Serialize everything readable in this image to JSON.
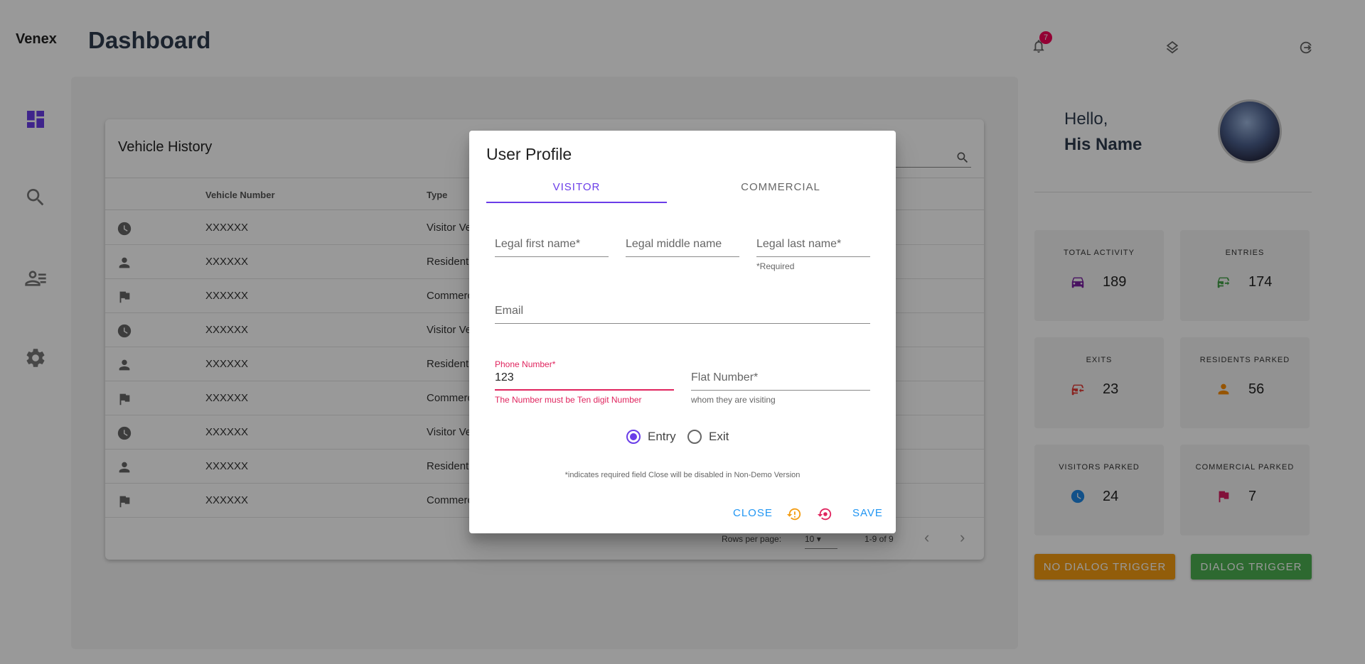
{
  "app": {
    "brand": "Venex",
    "page_title": "Dashboard",
    "notification_count": "7"
  },
  "history": {
    "title": "Vehicle History",
    "columns": [
      "Vehicle Number",
      "Type"
    ],
    "rows": [
      {
        "icon": "clock-icon",
        "number": "XXXXXX",
        "type": "Visitor Ve"
      },
      {
        "icon": "person-icon",
        "number": "XXXXXX",
        "type": "Resident"
      },
      {
        "icon": "flag-icon",
        "number": "XXXXXX",
        "type": "Commerc"
      },
      {
        "icon": "clock-icon",
        "number": "XXXXXX",
        "type": "Visitor Ve"
      },
      {
        "icon": "person-icon",
        "number": "XXXXXX",
        "type": "Resident"
      },
      {
        "icon": "flag-icon",
        "number": "XXXXXX",
        "type": "Commerc"
      },
      {
        "icon": "clock-icon",
        "number": "XXXXXX",
        "type": "Visitor Ve"
      },
      {
        "icon": "person-icon",
        "number": "XXXXXX",
        "type": "Resident"
      },
      {
        "icon": "flag-icon",
        "number": "XXXXXX",
        "type": "Commerc"
      }
    ],
    "rows_per_page_label": "Rows per page:",
    "rows_per_page": "10",
    "range": "1-9 of 9"
  },
  "profile": {
    "hello": "Hello,",
    "name": "His Name"
  },
  "stats": [
    {
      "label": "TOTAL ACTIVITY",
      "value": "189",
      "icon": "car-icon",
      "color": "#7b1fa2"
    },
    {
      "label": "ENTRIES",
      "value": "174",
      "icon": "car-entry-icon",
      "color": "#43a047"
    },
    {
      "label": "EXITS",
      "value": "23",
      "icon": "car-exit-icon",
      "color": "#e53935"
    },
    {
      "label": "RESIDENTS PARKED",
      "value": "56",
      "icon": "person-icon",
      "color": "#fb8c00"
    },
    {
      "label": "VISITORS PARKED",
      "value": "24",
      "icon": "clock-icon",
      "color": "#1e88e5"
    },
    {
      "label": "COMMERCIAL PARKED",
      "value": "7",
      "icon": "flag-icon",
      "color": "#d81b60"
    }
  ],
  "triggers": {
    "no_dialog": "NO DIALOG TRIGGER",
    "dialog": "DIALOG TRIGGER",
    "no_dialog_color": "#f39c12",
    "dialog_color": "#4caf50"
  },
  "dialog": {
    "title": "User Profile",
    "tabs": [
      "VISITOR",
      "COMMERCIAL"
    ],
    "active_tab": "VISITOR",
    "fields": {
      "first_name": "Legal first name*",
      "middle_name": "Legal middle name",
      "last_name": "Legal last name*",
      "last_name_helper": "*Required",
      "email": "Email",
      "phone_label": "Phone Number*",
      "phone_value": "123",
      "phone_error": "The Number must be Ten digit Number",
      "flat": "Flat Number*",
      "flat_helper": "whom they are visiting"
    },
    "radio": {
      "options": [
        "Entry",
        "Exit"
      ],
      "selected": "Entry"
    },
    "note": "*indicates required field Close will be disabled in Non-Demo Version",
    "buttons": {
      "close": "CLOSE",
      "save": "SAVE"
    },
    "accent": "#6a3de8",
    "error_color": "#e0245e"
  }
}
